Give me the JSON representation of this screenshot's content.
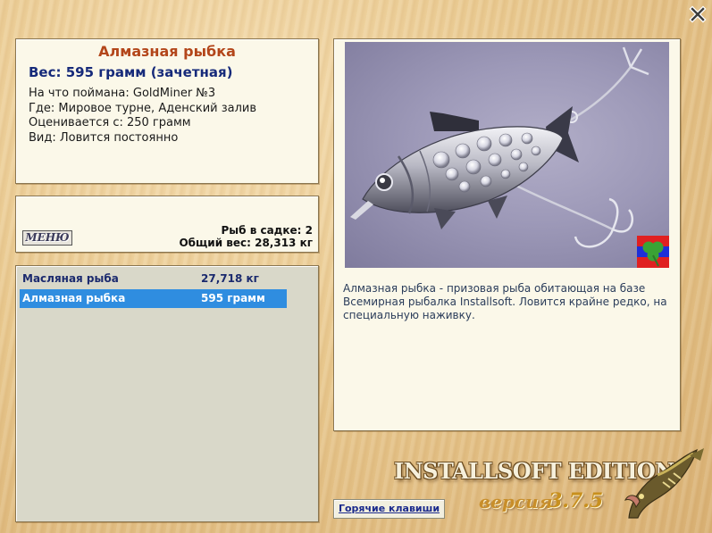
{
  "fish_info": {
    "title": "Алмазная рыбка",
    "weight": "Вес: 595 грамм (зачетная)",
    "caught_on": "На что поймана: GoldMiner №3",
    "location": "Где: Мировое турне, Аденский залив",
    "rated_from": "Оценивается с: 250 грамм",
    "kind": "Вид: Ловится постоянно"
  },
  "cage": {
    "menu_label": "МЕНЮ",
    "count": "Рыб в садке: 2",
    "total_weight": "Общий вес: 28,313 кг"
  },
  "fish_list": [
    {
      "name": "Масляная рыба",
      "weight": "27,718 кг",
      "selected": false
    },
    {
      "name": "Алмазная рыбка",
      "weight": "595 грамм",
      "selected": true
    }
  ],
  "description": "Алмазная рыбка - призовая рыба обитающая на базе Всемирная рыбалка Installsoft. Ловится крайне редко, на специальную наживку.",
  "branding": {
    "edition": "INSTALLSOFT EDITION",
    "version_label": "версия",
    "version": "3.7.5"
  },
  "hotkeys_label": "Горячие клавиши",
  "icons": {
    "close": "close-icon",
    "badge": "clover-badge-icon",
    "logo": "pike-logo"
  },
  "colors": {
    "title": "#b3461a",
    "weight": "#162a7a",
    "selection": "#2f8de0",
    "link": "#1b2a8c"
  }
}
